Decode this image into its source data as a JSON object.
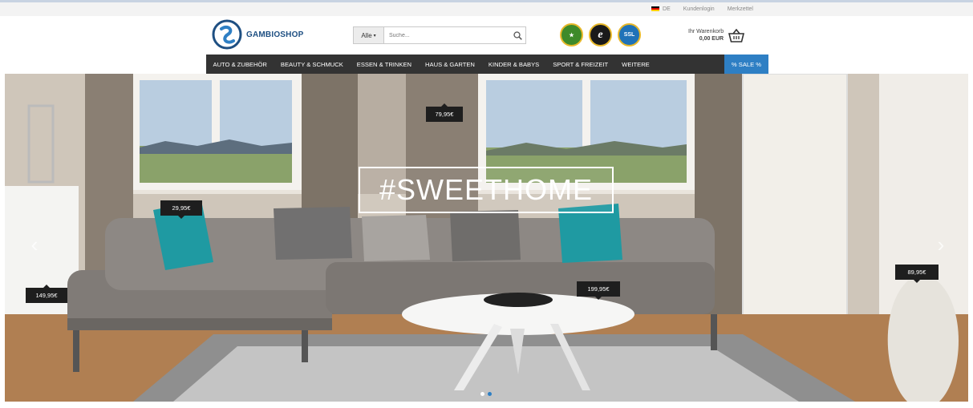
{
  "topbar": {
    "language": "DE",
    "login": "Kundenlogin",
    "wishlist": "Merkzettel"
  },
  "header": {
    "logo_text": "GAMBIOSHOP",
    "search_category": "Alle",
    "search_placeholder": "Suche...",
    "cart_label": "Ihr Warenkorb",
    "cart_amount": "0,00 EUR",
    "badges": [
      "award-badge",
      "trusted-shops-e",
      "SSL"
    ]
  },
  "nav": {
    "items": [
      "AUTO & ZUBEHÖR",
      "BEAUTY & SCHMUCK",
      "ESSEN & TRINKEN",
      "HAUS & GARTEN",
      "KINDER & BABYS",
      "SPORT & FREIZEIT",
      "WEITERE"
    ],
    "sale": "% SALE %"
  },
  "hero": {
    "headline": "#SWEETHOME",
    "price_tags": [
      "79,95€",
      "29,95€",
      "149,95€",
      "199,95€",
      "89,95€"
    ],
    "slide_count": 2,
    "active_slide": 2
  },
  "colors": {
    "nav_bg": "#333333",
    "accent": "#2e7fc4",
    "brand": "#1e4f82"
  }
}
